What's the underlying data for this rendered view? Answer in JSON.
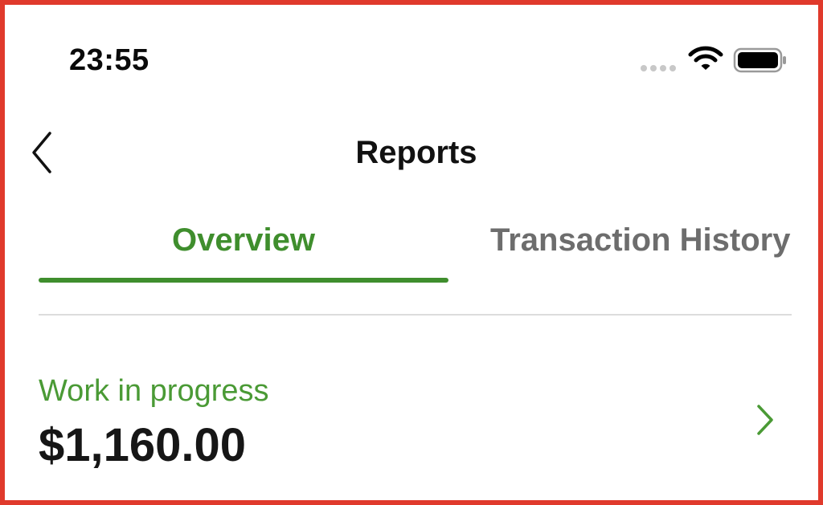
{
  "status_bar": {
    "time": "23:55",
    "icons": [
      "cellular-signal-icon",
      "wifi-icon",
      "battery-icon"
    ]
  },
  "nav": {
    "back_icon": "chevron-left-icon",
    "title": "Reports"
  },
  "tabs": [
    {
      "label": "Overview",
      "active": true
    },
    {
      "label": "Transaction History",
      "active": false
    }
  ],
  "work_in_progress": {
    "label": "Work in progress",
    "amount": "$1,160.00",
    "icon": "chevron-right-icon"
  },
  "colors": {
    "accent_green": "#3f8e2d",
    "label_green": "#4a9a35",
    "inactive_tab": "#6d6d6d",
    "frame_border": "#e03a2c"
  }
}
